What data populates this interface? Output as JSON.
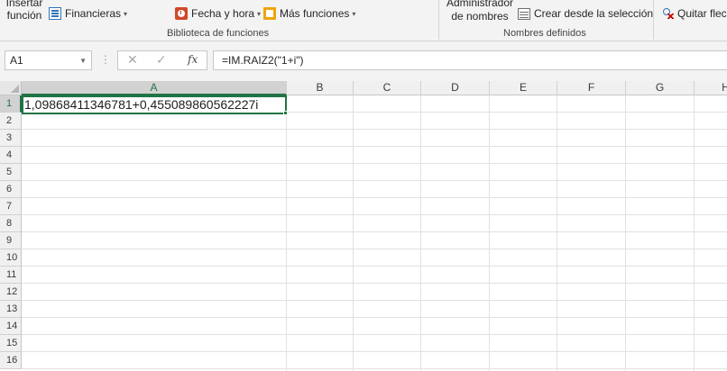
{
  "ribbon": {
    "insert_function_line1": "Insertar",
    "insert_function_line2": "función",
    "financial": "Financieras",
    "date_time": "Fecha y hora",
    "more_functions": "Más funciones",
    "library_group": "Biblioteca de funciones",
    "name_manager_line1": "Administrador",
    "name_manager_line2": "de nombres",
    "create_from_selection": "Crear desde la selección",
    "defined_names_group": "Nombres definidos",
    "remove_arrows": "Quitar flec"
  },
  "formula_bar": {
    "name_box": "A1",
    "cancel_glyph": "✕",
    "enter_glyph": "✓",
    "fx": "fx",
    "formula": "=IM.RAIZ2(\"1+i\")"
  },
  "sheet": {
    "columns": [
      "A",
      "B",
      "C",
      "D",
      "E",
      "F",
      "G",
      "H"
    ],
    "rows": [
      "1",
      "2",
      "3",
      "4",
      "5",
      "6",
      "7",
      "8",
      "9",
      "10",
      "11",
      "12",
      "13",
      "14",
      "15",
      "16"
    ],
    "selected_cell": "A1",
    "cells": {
      "A1": "1,09868411346781+0,455089860562227i"
    }
  },
  "colors": {
    "accent": "#217346",
    "ribbon_bg": "#f3f3f3",
    "header_bg": "#f0f0f0",
    "header_selected_bg": "#d2d2d2",
    "gridline": "#e1e1e1"
  }
}
